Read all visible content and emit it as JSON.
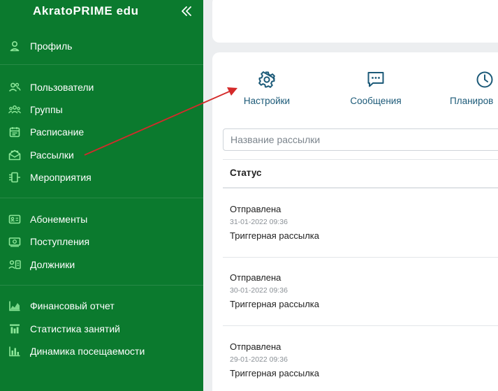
{
  "sidebar": {
    "brand": "AkratoPRIME edu",
    "items": [
      {
        "label": "Профиль",
        "icon": "user-icon"
      },
      {
        "label": "Пользователи",
        "icon": "users-icon"
      },
      {
        "label": "Группы",
        "icon": "groups-icon"
      },
      {
        "label": "Расписание",
        "icon": "calendar-icon"
      },
      {
        "label": "Рассылки",
        "icon": "mail-open-icon"
      },
      {
        "label": "Мероприятия",
        "icon": "events-icon"
      },
      {
        "label": "Абонементы",
        "icon": "id-card-icon"
      },
      {
        "label": "Поступления",
        "icon": "cash-icon"
      },
      {
        "label": "Должники",
        "icon": "debtor-icon"
      },
      {
        "label": "Финансовый отчет",
        "icon": "area-chart-icon"
      },
      {
        "label": "Статистика занятий",
        "icon": "bar-stats-icon"
      },
      {
        "label": "Динамика посещаемости",
        "icon": "bar-chart-icon"
      }
    ]
  },
  "tabs": [
    {
      "label": "Настройки",
      "icon": "gear-icon"
    },
    {
      "label": "Сообщения",
      "icon": "message-icon"
    },
    {
      "label": "Планиров",
      "icon": "clock-icon"
    }
  ],
  "search": {
    "placeholder": "Название рассылки"
  },
  "table": {
    "header": "Статус",
    "rows": [
      {
        "status": "Отправлена",
        "date": "31-01-2022 09:36",
        "type": "Триггерная рассылка"
      },
      {
        "status": "Отправлена",
        "date": "30-01-2022 09:36",
        "type": "Триггерная рассылка"
      },
      {
        "status": "Отправлена",
        "date": "29-01-2022 09:36",
        "type": "Триггерная рассылка"
      }
    ]
  },
  "colors": {
    "sidebar": "#0b7a2e",
    "icon_accent": "#8ee89a",
    "tab_text": "#1c5a78",
    "arrow": "#d42a2a"
  }
}
